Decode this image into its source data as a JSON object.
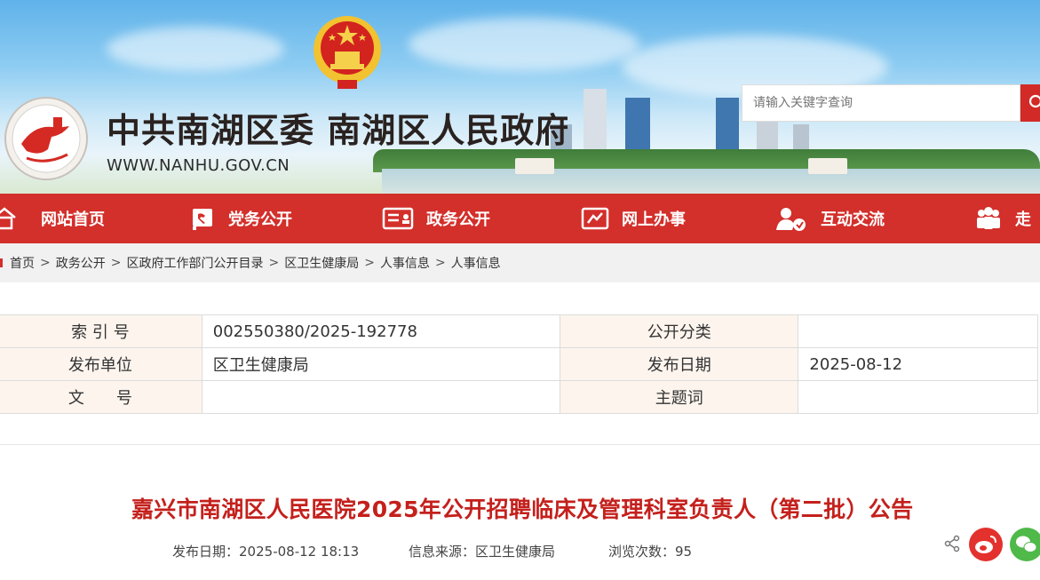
{
  "header": {
    "title": "中共南湖区委 南湖区人民政府",
    "url": "WWW.NANHU.GOV.CN",
    "search_placeholder": "请输入关键字查询"
  },
  "nav": {
    "items": [
      {
        "label": "网站首页",
        "icon": "home-icon"
      },
      {
        "label": "党务公开",
        "icon": "party-flag-icon"
      },
      {
        "label": "政务公开",
        "icon": "id-card-icon"
      },
      {
        "label": "网上办事",
        "icon": "handshake-icon"
      },
      {
        "label": "互动交流",
        "icon": "user-chat-icon"
      },
      {
        "label": "走",
        "icon": "people-group-icon"
      }
    ]
  },
  "breadcrumb": {
    "items": [
      "首页",
      "政务公开",
      "区政府工作部门公开目录",
      "区卫生健康局",
      "人事信息",
      "人事信息"
    ],
    "separator": ">"
  },
  "meta": {
    "index_label": "索 引 号",
    "index_value": "002550380/2025-192778",
    "category_label": "公开分类",
    "category_value": "",
    "publisher_label": "发布单位",
    "publisher_value": "区卫生健康局",
    "date_label": "发布日期",
    "date_value": "2025-08-12",
    "docno_label": "文　　号",
    "docno_value": "",
    "keywords_label": "主题词",
    "keywords_value": ""
  },
  "article": {
    "title": "嘉兴市南湖区人民医院2025年公开招聘临床及管理科室负责人（第二批）公告",
    "publish_label": "发布日期：",
    "publish_value": "2025-08-12 18:13",
    "source_label": "信息来源：",
    "source_value": "区卫生健康局",
    "views_label": "浏览次数：",
    "views_value": "95"
  },
  "colors": {
    "nav_red": "#d32f2b",
    "title_red": "#c4201c",
    "label_bg": "#fcf4ed",
    "weibo_red": "#e3312d",
    "wechat_green": "#4fb94a"
  }
}
